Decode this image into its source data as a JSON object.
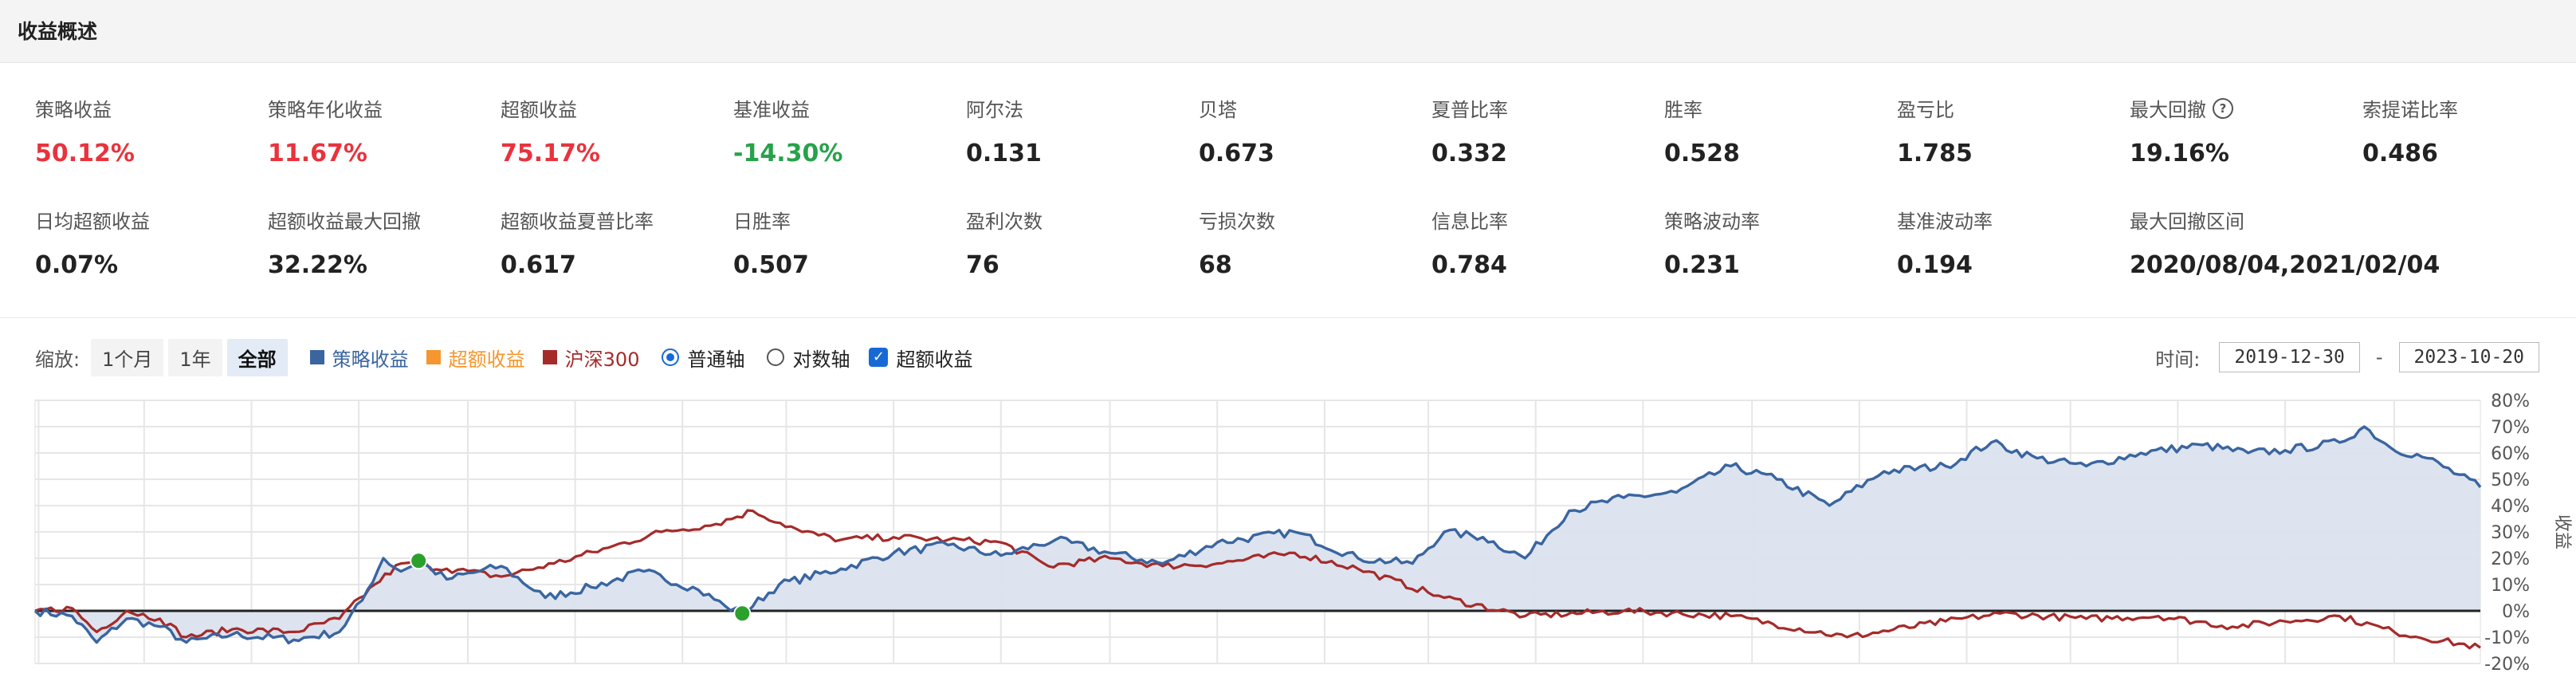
{
  "header": {
    "title": "收益概述"
  },
  "metrics_row1": [
    {
      "label": "策略收益",
      "value": "50.12%",
      "color": "red"
    },
    {
      "label": "策略年化收益",
      "value": "11.67%",
      "color": "red"
    },
    {
      "label": "超额收益",
      "value": "75.17%",
      "color": "red"
    },
    {
      "label": "基准收益",
      "value": "-14.30%",
      "color": "green"
    },
    {
      "label": "阿尔法",
      "value": "0.131",
      "color": ""
    },
    {
      "label": "贝塔",
      "value": "0.673",
      "color": ""
    },
    {
      "label": "夏普比率",
      "value": "0.332",
      "color": ""
    },
    {
      "label": "胜率",
      "value": "0.528",
      "color": ""
    },
    {
      "label": "盈亏比",
      "value": "1.785",
      "color": ""
    },
    {
      "label": "最大回撤",
      "value": "19.16%",
      "color": "",
      "icon": "question-circle-icon"
    },
    {
      "label": "索提诺比率",
      "value": "0.486",
      "color": ""
    }
  ],
  "metrics_row2": [
    {
      "label": "日均超额收益",
      "value": "0.07%"
    },
    {
      "label": "超额收益最大回撤",
      "value": "32.22%"
    },
    {
      "label": "超额收益夏普比率",
      "value": "0.617"
    },
    {
      "label": "日胜率",
      "value": "0.507"
    },
    {
      "label": "盈利次数",
      "value": "76"
    },
    {
      "label": "亏损次数",
      "value": "68"
    },
    {
      "label": "信息比率",
      "value": "0.784"
    },
    {
      "label": "策略波动率",
      "value": "0.231"
    },
    {
      "label": "基准波动率",
      "value": "0.194"
    },
    {
      "label": "最大回撤区间",
      "value": "2020/08/04,2021/02/04"
    }
  ],
  "controls": {
    "zoom_label": "缩放:",
    "zoom_buttons": [
      "1个月",
      "1年",
      "全部"
    ],
    "zoom_active": "全部",
    "legend": [
      {
        "name": "策略收益",
        "color": "#3a65a0"
      },
      {
        "name": "超额收益",
        "color": "#f5962e"
      },
      {
        "name": "沪深300",
        "color": "#a52b2b"
      }
    ],
    "axis_normal": "普通轴",
    "axis_log": "对数轴",
    "excess_checkbox": "超额收益",
    "time_label": "时间:",
    "date_start": "2019-12-30",
    "date_end": "2023-10-20",
    "date_sep": "-"
  },
  "colors": {
    "strategy": "#3a65a0",
    "strategy_fill": "#dbe3ee",
    "benchmark": "#a52b2b",
    "excess": "#f5962e",
    "drawdown_marker": "#2ca02c"
  },
  "chart_data": {
    "type": "line",
    "x_start": "2019-12-30",
    "x_end": "2023-10-20",
    "ylabel": "收益",
    "yticks": [
      "80%",
      "70%",
      "60%",
      "50%",
      "40%",
      "30%",
      "20%",
      "10%",
      "0%",
      "-10%",
      "-20%"
    ],
    "ylim": [
      -20,
      80
    ],
    "grid": true,
    "series": [
      {
        "name": "策略收益",
        "points": [
          [
            "2019-12-30",
            0
          ],
          [
            "2020-01-20",
            -2
          ],
          [
            "2020-02-03",
            -12
          ],
          [
            "2020-02-20",
            -3
          ],
          [
            "2020-03-10",
            -6
          ],
          [
            "2020-03-25",
            -12
          ],
          [
            "2020-04-20",
            -9
          ],
          [
            "2020-05-25",
            -11
          ],
          [
            "2020-06-20",
            -8
          ],
          [
            "2020-07-03",
            4
          ],
          [
            "2020-07-15",
            20
          ],
          [
            "2020-07-25",
            15
          ],
          [
            "2020-08-04",
            19
          ],
          [
            "2020-08-20",
            12
          ],
          [
            "2020-09-20",
            17
          ],
          [
            "2020-10-15",
            5
          ],
          [
            "2020-11-10",
            9
          ],
          [
            "2020-12-10",
            15
          ],
          [
            "2021-01-10",
            8
          ],
          [
            "2021-01-25",
            2
          ],
          [
            "2021-02-04",
            -1
          ],
          [
            "2021-02-25",
            10
          ],
          [
            "2021-04-01",
            16
          ],
          [
            "2021-05-01",
            22
          ],
          [
            "2021-06-01",
            25
          ],
          [
            "2021-07-01",
            21
          ],
          [
            "2021-08-01",
            27
          ],
          [
            "2021-09-01",
            22
          ],
          [
            "2021-10-01",
            18
          ],
          [
            "2021-11-01",
            26
          ],
          [
            "2021-12-15",
            30
          ],
          [
            "2022-01-20",
            20
          ],
          [
            "2022-02-20",
            18
          ],
          [
            "2022-03-10",
            30
          ],
          [
            "2022-04-01",
            28
          ],
          [
            "2022-04-25",
            20
          ],
          [
            "2022-05-20",
            38
          ],
          [
            "2022-06-20",
            43
          ],
          [
            "2022-07-20",
            45
          ],
          [
            "2022-08-20",
            55
          ],
          [
            "2022-09-15",
            50
          ],
          [
            "2022-10-15",
            40
          ],
          [
            "2022-11-15",
            53
          ],
          [
            "2022-12-20",
            55
          ],
          [
            "2023-01-15",
            64
          ],
          [
            "2023-02-10",
            58
          ],
          [
            "2023-03-10",
            55
          ],
          [
            "2023-04-10",
            60
          ],
          [
            "2023-05-15",
            63
          ],
          [
            "2023-06-10",
            60
          ],
          [
            "2023-07-01",
            61
          ],
          [
            "2023-08-01",
            64
          ],
          [
            "2023-08-15",
            70
          ],
          [
            "2023-08-30",
            62
          ],
          [
            "2023-09-20",
            58
          ],
          [
            "2023-10-20",
            47
          ]
        ]
      },
      {
        "name": "沪深300",
        "points": [
          [
            "2019-12-30",
            0
          ],
          [
            "2020-01-20",
            1
          ],
          [
            "2020-02-03",
            -8
          ],
          [
            "2020-02-20",
            0
          ],
          [
            "2020-03-10",
            -3
          ],
          [
            "2020-03-25",
            -10
          ],
          [
            "2020-04-20",
            -7
          ],
          [
            "2020-05-25",
            -8
          ],
          [
            "2020-06-20",
            -3
          ],
          [
            "2020-07-10",
            10
          ],
          [
            "2020-07-25",
            18
          ],
          [
            "2020-08-20",
            16
          ],
          [
            "2020-09-20",
            13
          ],
          [
            "2020-10-20",
            18
          ],
          [
            "2020-11-20",
            24
          ],
          [
            "2020-12-20",
            30
          ],
          [
            "2021-01-20",
            33
          ],
          [
            "2021-02-10",
            38
          ],
          [
            "2021-03-10",
            30
          ],
          [
            "2021-04-01",
            27
          ],
          [
            "2021-05-01",
            28
          ],
          [
            "2021-06-01",
            27
          ],
          [
            "2021-07-01",
            26
          ],
          [
            "2021-07-28",
            17
          ],
          [
            "2021-09-01",
            20
          ],
          [
            "2021-10-01",
            17
          ],
          [
            "2021-11-01",
            18
          ],
          [
            "2021-12-15",
            22
          ],
          [
            "2022-01-20",
            16
          ],
          [
            "2022-03-10",
            5
          ],
          [
            "2022-04-25",
            -2
          ],
          [
            "2022-06-20",
            0
          ],
          [
            "2022-08-20",
            -2
          ],
          [
            "2022-10-25",
            -10
          ],
          [
            "2022-12-20",
            -4
          ],
          [
            "2023-01-20",
            -1
          ],
          [
            "2023-03-10",
            -3
          ],
          [
            "2023-04-20",
            -2
          ],
          [
            "2023-06-01",
            -6
          ],
          [
            "2023-07-01",
            -4
          ],
          [
            "2023-08-01",
            -2
          ],
          [
            "2023-09-01",
            -8
          ],
          [
            "2023-10-20",
            -14
          ]
        ]
      }
    ],
    "markers": [
      {
        "x": "2020-08-04",
        "y": 19
      },
      {
        "x": "2021-02-04",
        "y": -1
      }
    ]
  }
}
